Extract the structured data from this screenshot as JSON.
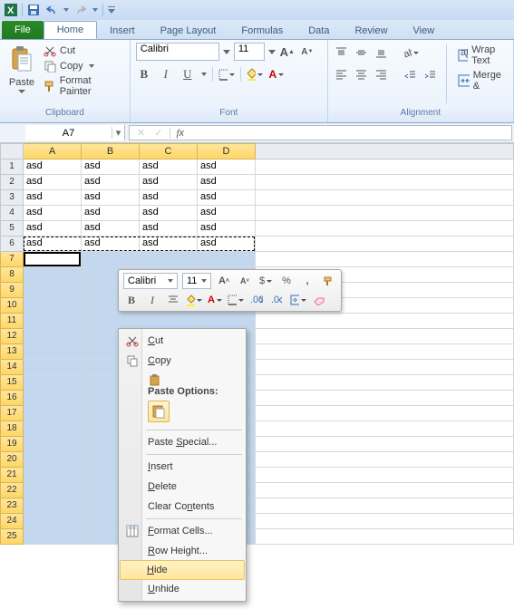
{
  "titlebar": {
    "app": "Microsoft Excel"
  },
  "tabs": {
    "file": "File",
    "home": "Home",
    "insert": "Insert",
    "pagelayout": "Page Layout",
    "formulas": "Formulas",
    "data": "Data",
    "review": "Review",
    "view": "View",
    "active": "Home"
  },
  "ribbon": {
    "clipboard": {
      "paste": "Paste",
      "cut": "Cut",
      "copy": "Copy",
      "format_painter": "Format Painter",
      "label": "Clipboard"
    },
    "font": {
      "name": "Calibri",
      "size": "11",
      "label": "Font"
    },
    "alignment": {
      "wrap": "Wrap Text",
      "merge": "Merge &",
      "label": "Alignment"
    }
  },
  "namebox": "A7",
  "columns": [
    "A",
    "B",
    "C",
    "D"
  ],
  "data_rows": [
    {
      "n": 1,
      "cells": [
        "asd",
        "asd",
        "asd",
        "asd"
      ]
    },
    {
      "n": 2,
      "cells": [
        "asd",
        "asd",
        "asd",
        "asd"
      ]
    },
    {
      "n": 3,
      "cells": [
        "asd",
        "asd",
        "asd",
        "asd"
      ]
    },
    {
      "n": 4,
      "cells": [
        "asd",
        "asd",
        "asd",
        "asd"
      ]
    },
    {
      "n": 5,
      "cells": [
        "asd",
        "asd",
        "asd",
        "asd"
      ]
    },
    {
      "n": 6,
      "cells": [
        "asd",
        "asd",
        "asd",
        "asd"
      ]
    }
  ],
  "selected_rows": [
    7,
    8,
    9,
    10,
    11,
    12,
    13,
    14,
    15,
    16,
    17,
    18,
    19,
    20,
    21,
    22,
    23,
    24,
    25
  ],
  "mini_toolbar": {
    "font": "Calibri",
    "size": "11",
    "currency": "$",
    "percent": "%",
    "comma": ","
  },
  "context_menu": {
    "cut": "Cut",
    "copy": "Copy",
    "paste_options_hdr": "Paste Options:",
    "paste_special": "Paste Special...",
    "insert": "Insert",
    "delete": "Delete",
    "clear": "Clear Contents",
    "format_cells": "Format Cells...",
    "row_height": "Row Height...",
    "hide": "Hide",
    "unhide": "Unhide"
  }
}
